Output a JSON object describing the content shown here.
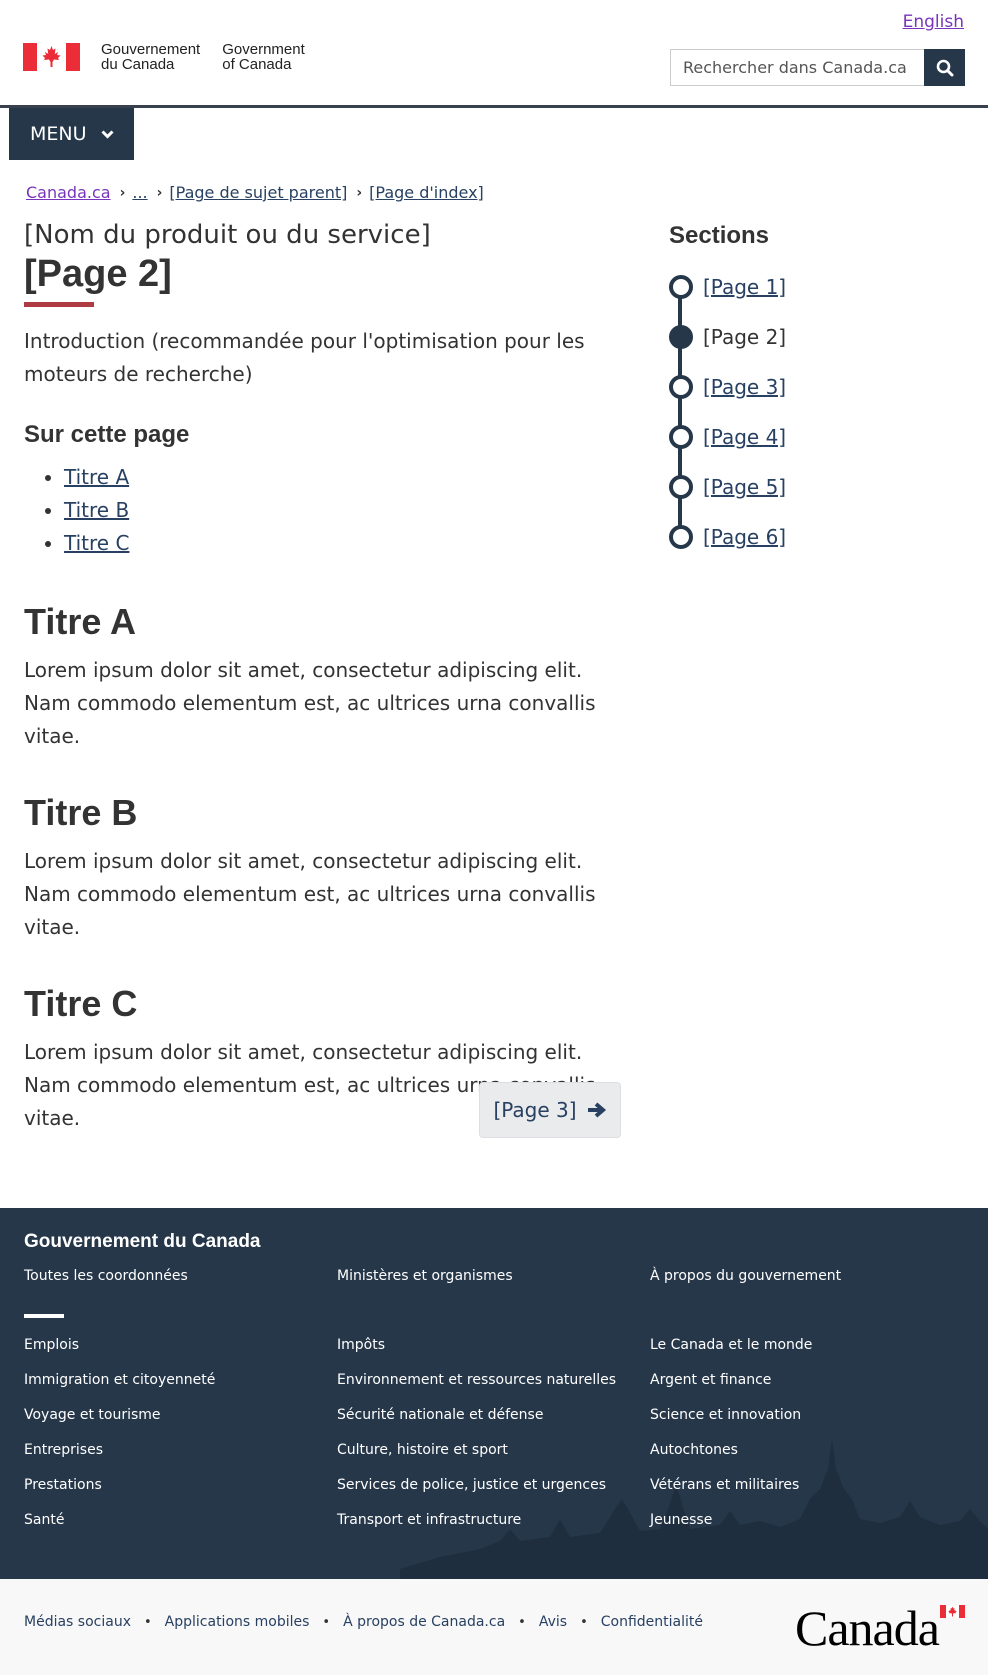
{
  "header": {
    "language_link": "English",
    "brand_fr": [
      "Gouvernement",
      "du Canada"
    ],
    "brand_en": [
      "Government",
      "of Canada"
    ],
    "search_placeholder": "Rechercher dans Canada.ca",
    "menu_label": "MENU"
  },
  "breadcrumb": [
    "Canada.ca",
    "...",
    "[Page de sujet parent]",
    "[Page d'index]"
  ],
  "main": {
    "product_name": "[Nom du produit ou du service]",
    "title": "[Page 2]",
    "intro": "Introduction (recommandée pour l'optimisation pour les moteurs de recherche)",
    "on_page_title": "Sur cette page",
    "on_page_links": [
      "Titre A",
      "Titre B",
      "Titre C"
    ],
    "sections": [
      {
        "title": "Titre A",
        "text": "Lorem ipsum dolor sit amet, consectetur adipiscing elit. Nam commodo elementum est, ac ultrices urna convallis vitae."
      },
      {
        "title": "Titre B",
        "text": "Lorem ipsum dolor sit amet, consectetur adipiscing elit. Nam commodo elementum est, ac ultrices urna convallis vitae."
      },
      {
        "title": "Titre C",
        "text": "Lorem ipsum dolor sit amet, consectetur adipiscing elit. Nam commodo elementum est, ac ultrices urna convallis vitae."
      }
    ],
    "next_button": "[Page 3]"
  },
  "sidebar": {
    "title": "Sections",
    "steps": [
      "[Page 1]",
      "[Page 2]",
      "[Page 3]",
      "[Page 4]",
      "[Page 5]",
      "[Page 6]"
    ],
    "current_step": "[Page 2]"
  },
  "footer": {
    "title": "Gouvernement du Canada",
    "top_links": [
      "Toutes les coordonnées",
      "Ministères et organismes",
      "À propos du gouvernement"
    ],
    "col1": [
      "Emplois",
      "Immigration et citoyenneté",
      "Voyage et tourisme",
      "Entreprises",
      "Prestations",
      "Santé"
    ],
    "col2": [
      "Impôts",
      "Environnement et ressources naturelles",
      "Sécurité nationale et défense",
      "Culture, histoire et sport",
      "Services de police, justice et urgences",
      "Transport et infrastructure"
    ],
    "col3": [
      "Le Canada et le monde",
      "Argent et finance",
      "Science et innovation",
      "Autochtones",
      "Vétérans et militaires",
      "Jeunesse"
    ]
  },
  "subfooter": {
    "links": [
      "Médias sociaux",
      "Applications mobiles",
      "À propos de Canada.ca",
      "Avis",
      "Confidentialité"
    ],
    "wordmark": "Canada"
  },
  "colors": {
    "primary_dark": "#26374a",
    "accent_red": "#af3c43",
    "link": "#284162",
    "visited_link": "#7834bc"
  },
  "icons": [
    "canada-flag-icon",
    "search-icon",
    "chevron-down-icon",
    "chevron-right-icon",
    "arrow-right-icon",
    "canada-flag-small-icon"
  ]
}
